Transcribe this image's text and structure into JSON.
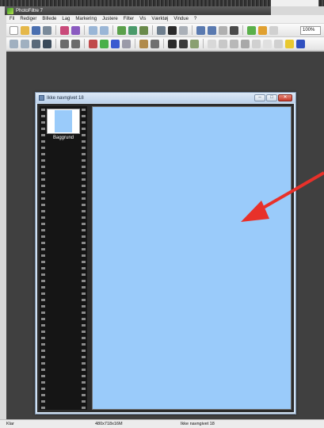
{
  "app": {
    "title": "PhotoFiltre 7"
  },
  "menu": [
    "Fil",
    "Rediger",
    "Billede",
    "Lag",
    "Markering",
    "Justere",
    "Filter",
    "Vis",
    "Værktøj",
    "Vindue",
    "?"
  ],
  "toolbar": {
    "zoom": "100%"
  },
  "document": {
    "title": "Ikke navngivet 18",
    "layer_name": "Baggrund",
    "canvas_color": "#9acbfa"
  },
  "status": {
    "state": "Klar",
    "size": "480x718x16M",
    "name": "Ikke navngivet 18"
  },
  "colors": {
    "accent_arrow": "#e8312a",
    "workspace": "#404040"
  }
}
